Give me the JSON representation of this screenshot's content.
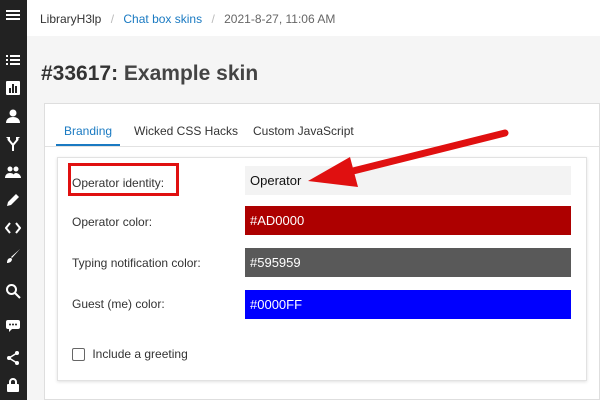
{
  "breadcrumb": {
    "home": "LibraryH3lp",
    "separator": "/",
    "section": "Chat box skins",
    "timestamp": "2021-8-27, 11:06 AM"
  },
  "page": {
    "id": "#33617:",
    "name": "Example skin"
  },
  "tabs": [
    {
      "label": "Branding",
      "active": true
    },
    {
      "label": "Wicked CSS Hacks",
      "active": false
    },
    {
      "label": "Custom JavaScript",
      "active": false
    }
  ],
  "branding": {
    "operator_identity": {
      "label": "Operator identity:",
      "value": "Operator"
    },
    "operator_color": {
      "label": "Operator color:",
      "value": "#AD0000",
      "color": "#AD0000"
    },
    "typing_color": {
      "label": "Typing notification color:",
      "value": "#595959",
      "color": "#595959"
    },
    "guest_color": {
      "label": "Guest (me) color:",
      "value": "#0000FF",
      "color": "#0000FF"
    },
    "greeting": {
      "label": "Include a greeting",
      "checked": false
    }
  },
  "annotation_color": "#E01010",
  "sidebar_icons": [
    "menu-icon",
    "list-icon",
    "chart-icon",
    "user-icon",
    "fork-icon",
    "users-icon",
    "pencil-icon",
    "code-icon",
    "brush-icon",
    "search-icon",
    "chat-icon",
    "share-icon",
    "lock-icon"
  ]
}
